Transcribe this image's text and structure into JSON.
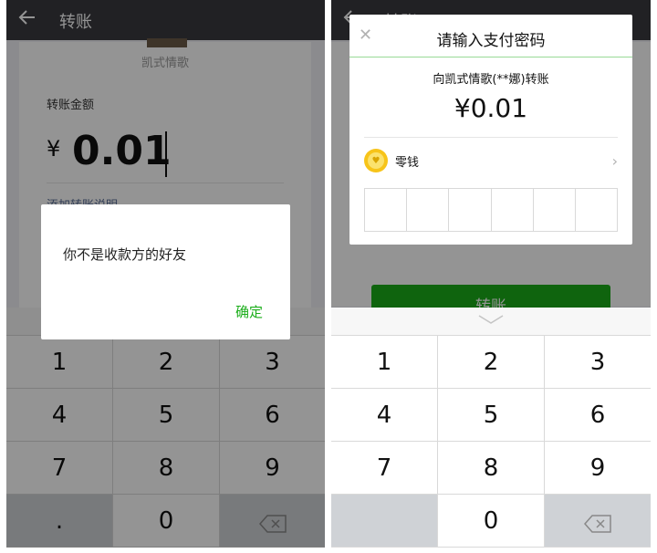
{
  "left": {
    "header": {
      "title": "转账"
    },
    "payee_name": "凯式情歌",
    "amount_label": "转账金额",
    "currency": "¥",
    "amount": "0.01",
    "add_note": "添加转账说明",
    "alert": {
      "message": "你不是收款方的好友",
      "ok_label": "确定"
    },
    "keypad": {
      "keys": [
        "1",
        "2",
        "3",
        "4",
        "5",
        "6",
        "7",
        "8",
        "9",
        ".",
        "0",
        ""
      ]
    }
  },
  "right": {
    "header": {
      "title": "转账"
    },
    "transfer_button": "转账",
    "dialog": {
      "title": "请输入支付密码",
      "payee": "向凯式情歌(**娜)转账",
      "amount": "¥0.01",
      "method": "零钱",
      "password_boxes": 6
    },
    "keypad": {
      "keys": [
        "1",
        "2",
        "3",
        "4",
        "5",
        "6",
        "7",
        "8",
        "9",
        "",
        "0",
        ""
      ]
    }
  },
  "colors": {
    "accent_green": "#1aad19",
    "header_bg": "#393a3f",
    "link_blue": "#576b95"
  }
}
